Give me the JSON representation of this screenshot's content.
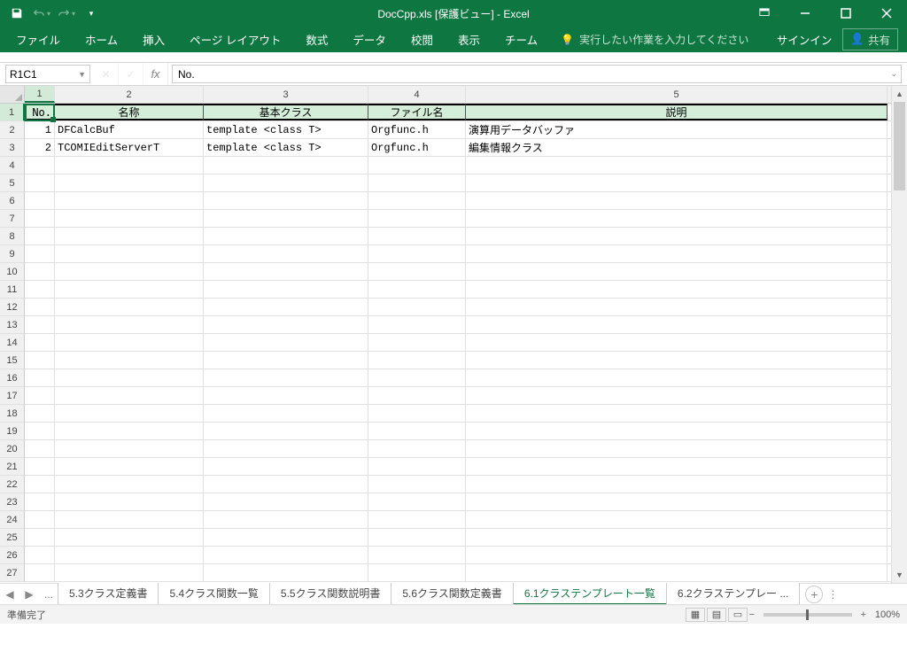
{
  "title": "DocCpp.xls [保護ビュー] - Excel",
  "qat": {
    "save": "save",
    "undo": "undo",
    "redo": "redo"
  },
  "ribbon": {
    "tabs": [
      "ファイル",
      "ホーム",
      "挿入",
      "ページ レイアウト",
      "数式",
      "データ",
      "校閲",
      "表示",
      "チーム"
    ],
    "tell_me": "実行したい作業を入力してください",
    "signin": "サインイン",
    "share": "共有"
  },
  "name_box": "R1C1",
  "formula": "No.",
  "columns": [
    "1",
    "2",
    "3",
    "4",
    "5"
  ],
  "rows": [
    "1",
    "2",
    "3",
    "4",
    "5",
    "6",
    "7",
    "8",
    "9",
    "10",
    "11",
    "12",
    "13",
    "14",
    "15",
    "16",
    "17",
    "18",
    "19",
    "20",
    "21",
    "22",
    "23",
    "24",
    "25",
    "26",
    "27"
  ],
  "headers": {
    "no": "No.",
    "name": "名称",
    "base": "基本クラス",
    "file": "ファイル名",
    "desc": "説明"
  },
  "data": [
    {
      "no": "1",
      "name": "DFCalcBuf",
      "base": "template <class T>",
      "file": "Orgfunc.h",
      "desc": "演算用データバッファ"
    },
    {
      "no": "2",
      "name": "TCOMIEditServerT",
      "base": "template <class T>",
      "file": "Orgfunc.h",
      "desc": "編集情報クラス"
    }
  ],
  "sheet_tabs": {
    "ellipsis": "...",
    "tabs": [
      "5.3クラス定義書",
      "5.4クラス関数一覧",
      "5.5クラス関数説明書",
      "5.6クラス関数定義書",
      "6.1クラステンプレート一覧",
      "6.2クラステンプレー ..."
    ],
    "active_index": 4
  },
  "status": "準備完了",
  "zoom": "100%"
}
